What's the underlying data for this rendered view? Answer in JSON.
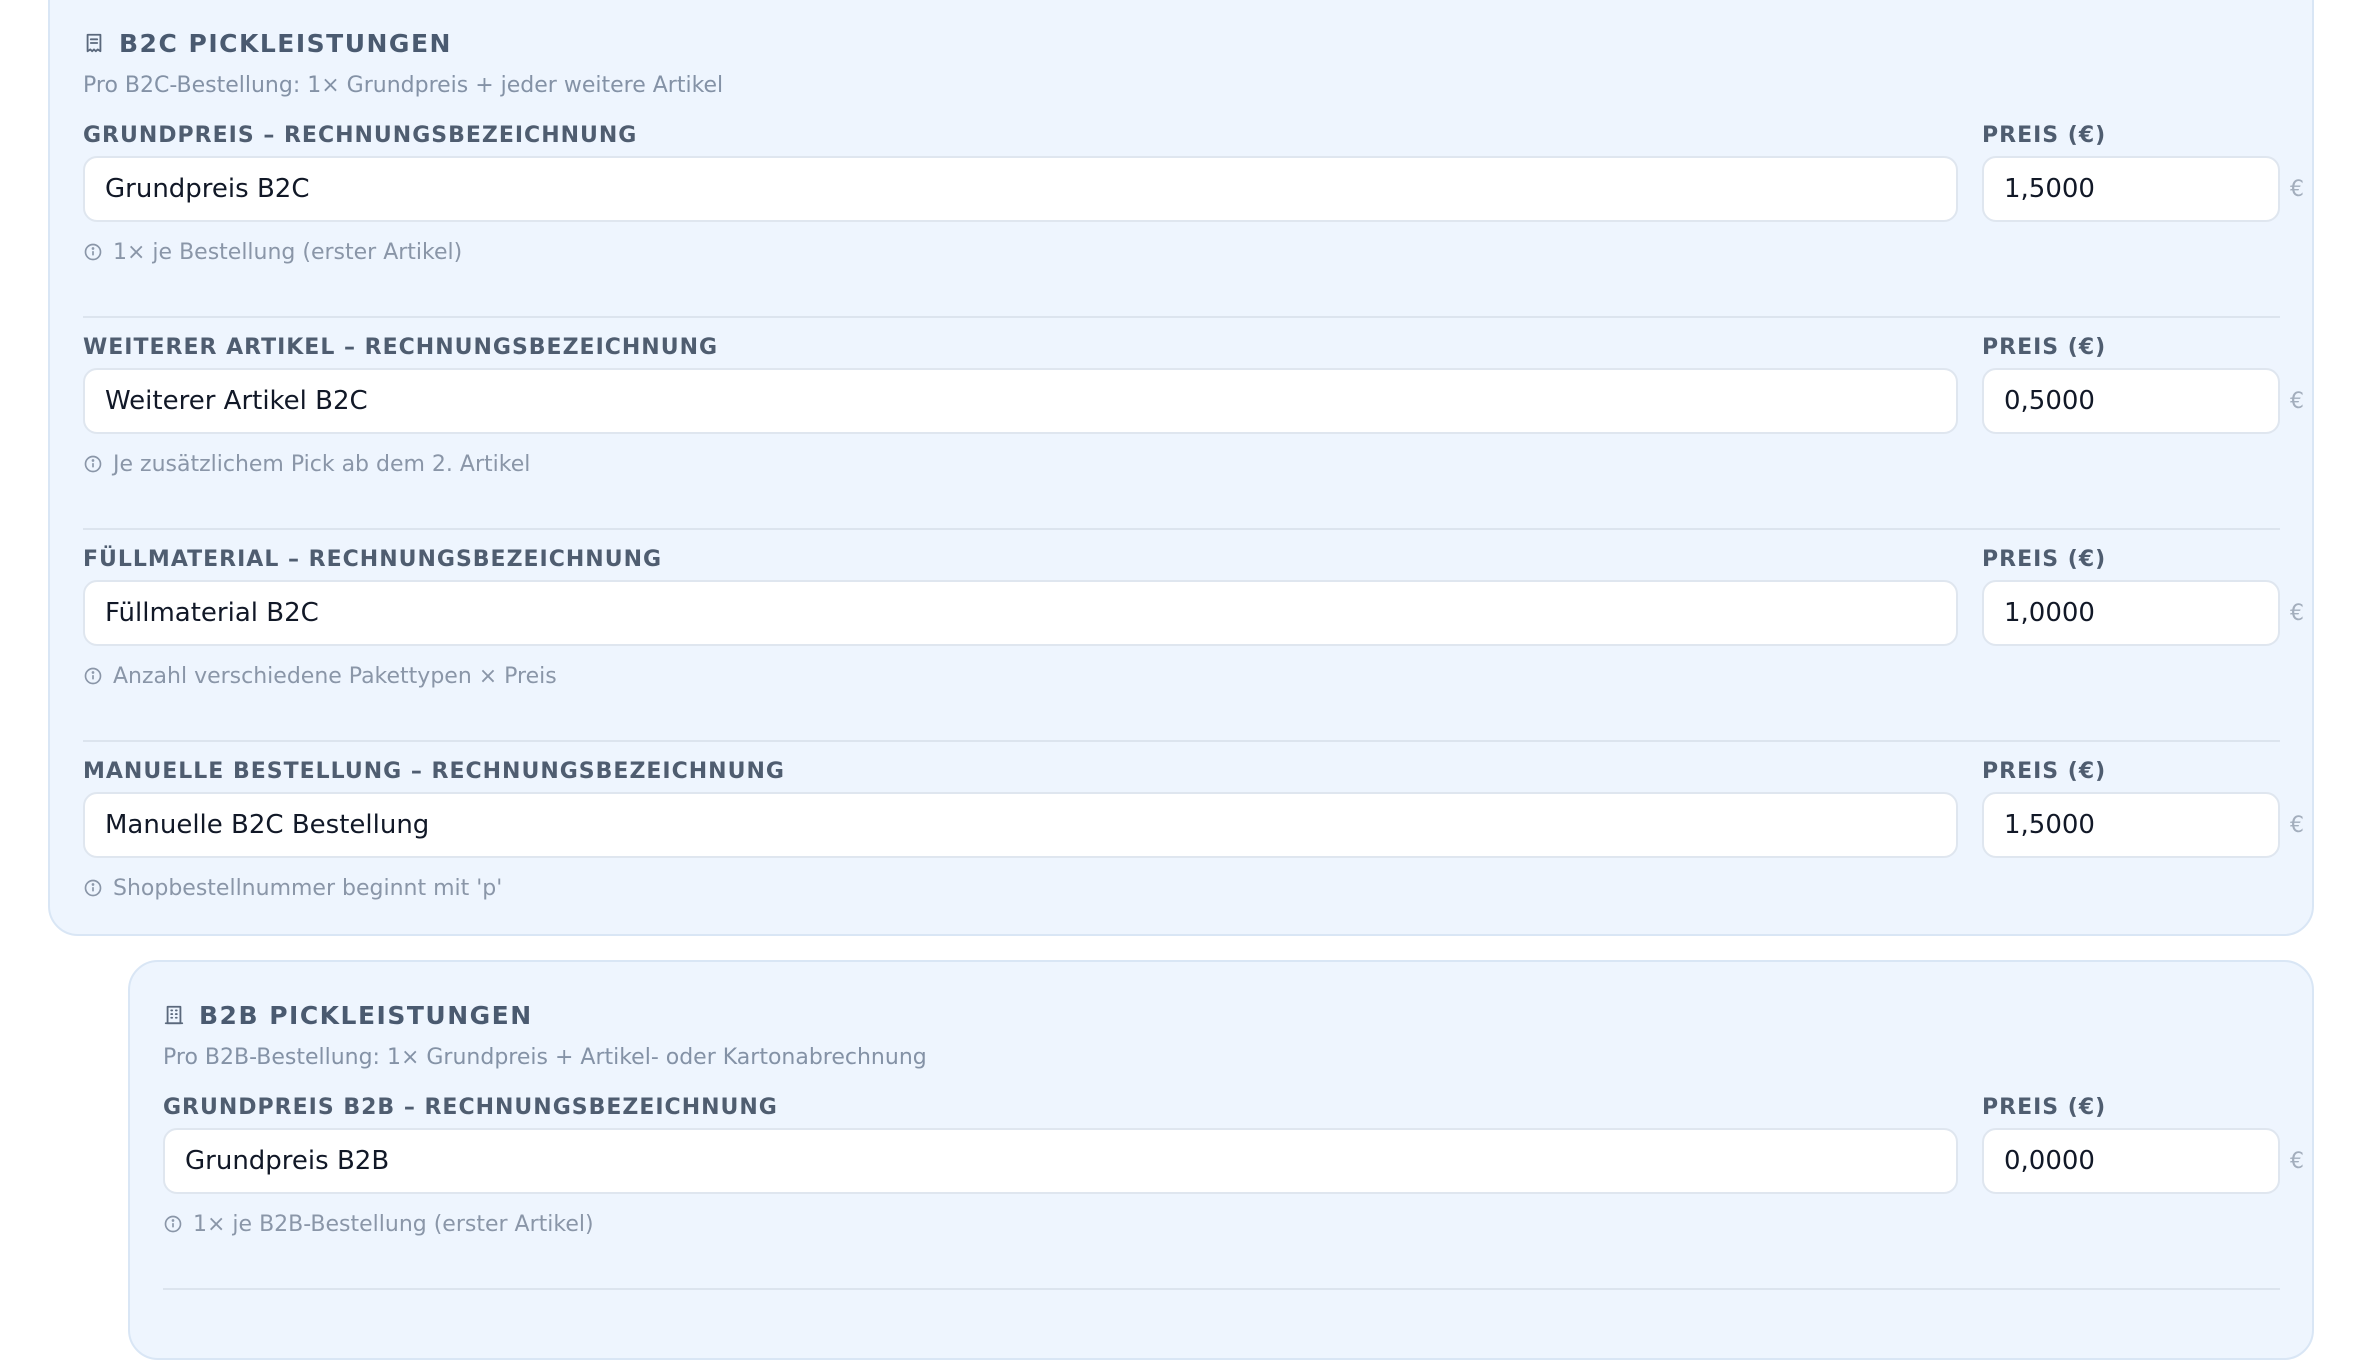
{
  "b2c": {
    "title": "B2C PICKLEISTUNGEN",
    "title_icon": "receipt-icon",
    "subtitle": "Pro B2C-Bestellung: 1× Grundpreis + jeder weitere Artikel",
    "price_label": "PREIS (€)",
    "currency": "€",
    "sections": [
      {
        "label": "GRUNDPREIS – RECHNUNGSBEZEICHNUNG",
        "name_value": "Grundpreis B2C",
        "price_value": "1,5000",
        "hint": "1× je Bestellung (erster Artikel)"
      },
      {
        "label": "WEITERER ARTIKEL – RECHNUNGSBEZEICHNUNG",
        "name_value": "Weiterer Artikel B2C",
        "price_value": "0,5000",
        "hint": "Je zusätzlichem Pick ab dem 2. Artikel"
      },
      {
        "label": "FÜLLMATERIAL – RECHNUNGSBEZEICHNUNG",
        "name_value": "Füllmaterial B2C",
        "price_value": "1,0000",
        "hint": "Anzahl verschiedene Pakettypen × Preis"
      },
      {
        "label": "MANUELLE BESTELLUNG – RECHNUNGSBEZEICHNUNG",
        "name_value": "Manuelle B2C Bestellung",
        "price_value": "1,5000",
        "hint": "Shopbestellnummer beginnt mit 'p'"
      }
    ]
  },
  "b2b": {
    "title": "B2B PICKLEISTUNGEN",
    "title_icon": "building-icon",
    "subtitle": "Pro B2B-Bestellung: 1× Grundpreis + Artikel- oder Kartonabrechnung",
    "price_label": "PREIS (€)",
    "currency": "€",
    "sections": [
      {
        "label": "GRUNDPREIS B2B – RECHNUNGSBEZEICHNUNG",
        "name_value": "Grundpreis B2B",
        "price_value": "0,0000",
        "hint": "1× je B2B-Bestellung (erster Artikel)"
      }
    ]
  },
  "hint_icon": "info-icon",
  "colors": {
    "panel_background": "#eef5fe",
    "panel_border": "#d9e6f5",
    "label_text": "#4f5d70",
    "hint_text": "#8a96a8"
  }
}
